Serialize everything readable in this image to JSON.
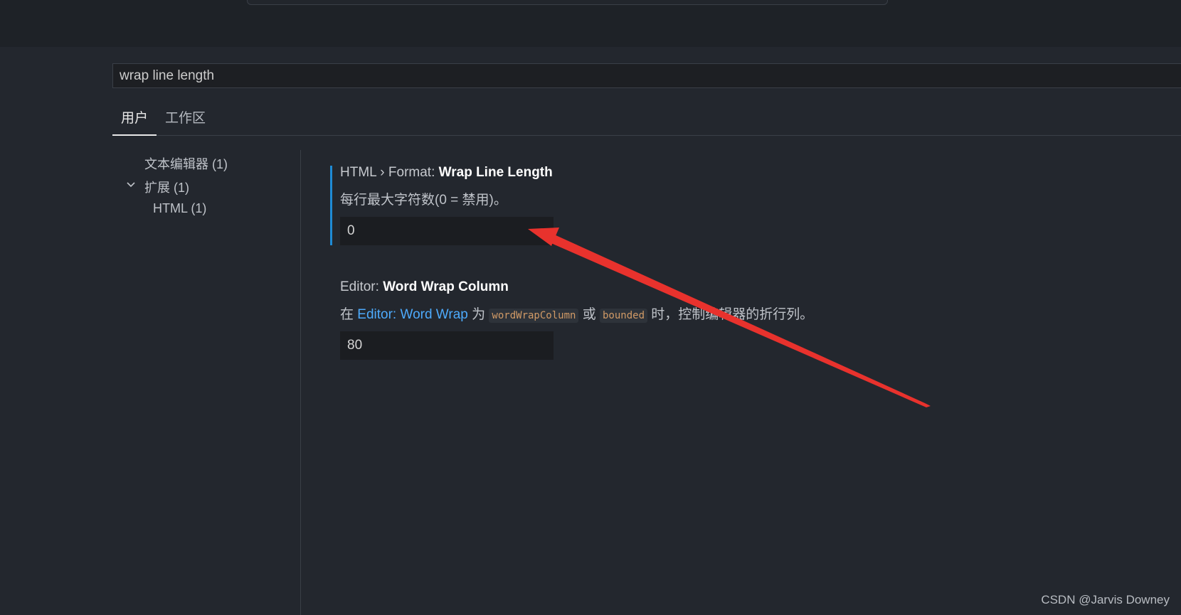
{
  "search": {
    "value": "wrap line length"
  },
  "tabs": [
    {
      "label": "用户",
      "active": true
    },
    {
      "label": "工作区",
      "active": false
    }
  ],
  "toc": {
    "items": [
      {
        "label": "文本编辑器 (1)"
      },
      {
        "label": "扩展 (1)",
        "expanded": true
      },
      {
        "label": "HTML (1)"
      }
    ]
  },
  "settings": [
    {
      "category": "HTML › Format: ",
      "name": "Wrap Line Length",
      "description": "每行最大字符数(0 = 禁用)。",
      "value": "0"
    },
    {
      "category": "Editor: ",
      "name": "Word Wrap Column",
      "desc_parts": {
        "p1": "在 ",
        "link": "Editor: Word Wrap",
        "p2": " 为 ",
        "code1": "wordWrapColumn",
        "p3": " 或 ",
        "code2": "bounded",
        "p4": " 时，控制编辑器的折行列。"
      },
      "value": "80"
    }
  ],
  "watermark": "CSDN @Jarvis Downey",
  "colors": {
    "accent": "#1e8bd6",
    "link": "#4daafc",
    "annotation_arrow": "#e8322d"
  }
}
